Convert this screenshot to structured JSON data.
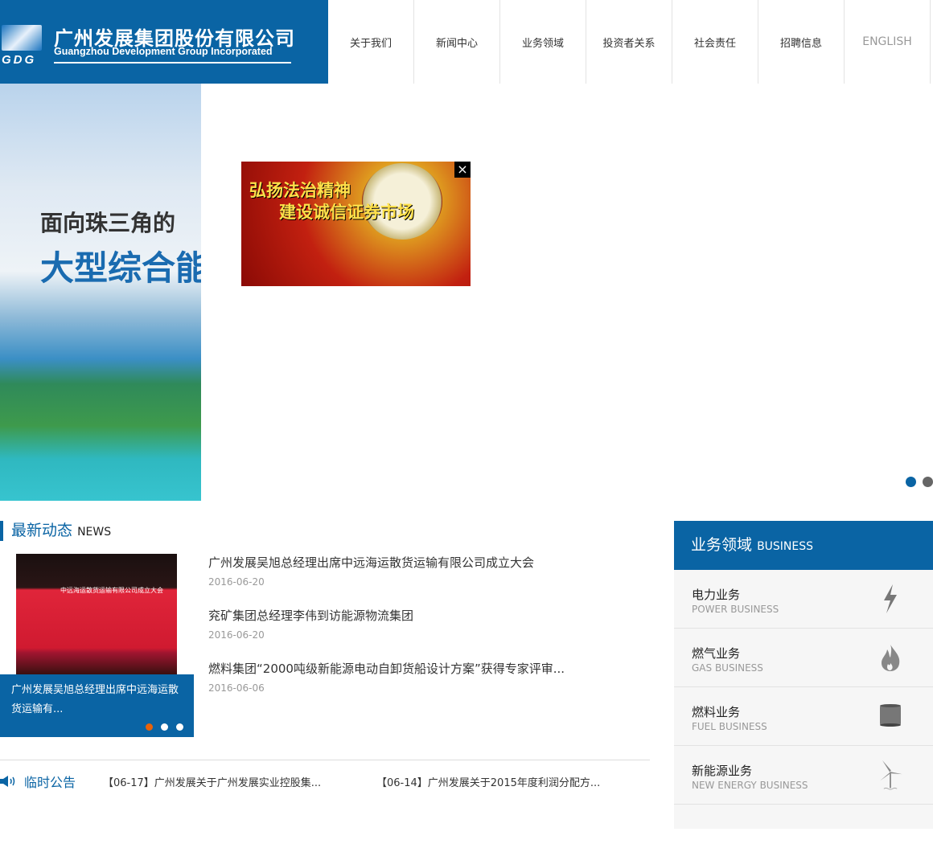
{
  "header": {
    "logo_cn": "广州发展集团股份有限公司",
    "logo_en": "Guangzhou Development Group Incorporated",
    "logo_abbr": "GDG",
    "nav": [
      "关于我们",
      "新闻中心",
      "业务领域",
      "投资者关系",
      "社会责任",
      "招聘信息",
      "ENGLISH"
    ]
  },
  "banner": {
    "line1": "面向珠三角的",
    "line2": "大型综合能",
    "ad_line1": "弘扬法治精神",
    "ad_line2": "建设诚信证券市场",
    "ad_close": "×",
    "slides": 2,
    "active_slide": 1
  },
  "news": {
    "title": "最新动态",
    "title_en": "NEWS",
    "photo_text": "中远海运散货运输有限公司成立大会",
    "caption": "广州发展吴旭总经理出席中远海运散货运输有...",
    "slides": 3,
    "active_slide": 1,
    "items": [
      {
        "title": "广州发展吴旭总经理出席中远海运散货运输有限公司成立大会",
        "date": "2016-06-20"
      },
      {
        "title": "兖矿集团总经理李伟到访能源物流集团",
        "date": "2016-06-20"
      },
      {
        "title": "燃料集团“2000吨级新能源电动自卸货船设计方案”获得专家评审...",
        "date": "2016-06-06"
      }
    ]
  },
  "notice": {
    "label": "临时公告",
    "items": [
      "【06-17】广州发展关于广州发展实业控股集...",
      "【06-14】广州发展关于2015年度利润分配方..."
    ]
  },
  "business": {
    "title": "业务领域",
    "title_en": "BUSINESS",
    "items": [
      {
        "cn": "电力业务",
        "en": "POWER BUSINESS",
        "icon": "lightning-icon"
      },
      {
        "cn": "燃气业务",
        "en": "GAS BUSINESS",
        "icon": "flame-icon"
      },
      {
        "cn": "燃料业务",
        "en": "FUEL BUSINESS",
        "icon": "barrel-icon"
      },
      {
        "cn": "新能源业务",
        "en": "NEW ENERGY BUSINESS",
        "icon": "wind-turbine-icon"
      }
    ]
  },
  "colors": {
    "brand": "#0a64a4",
    "accent": "#e8620a"
  }
}
